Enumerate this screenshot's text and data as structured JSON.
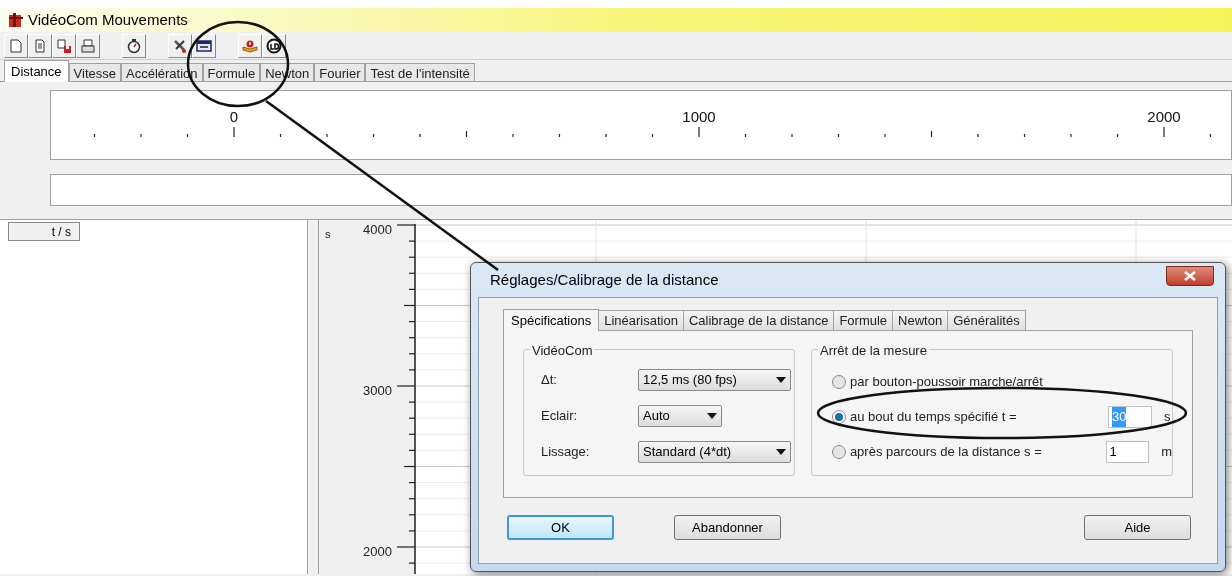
{
  "window": {
    "title": "VidéoCom Mouvements"
  },
  "tabs": [
    {
      "label": "Distance",
      "selected": true
    },
    {
      "label": "Vitesse",
      "selected": false
    },
    {
      "label": "Accélération",
      "selected": false
    },
    {
      "label": "Formule",
      "selected": false
    },
    {
      "label": "Newton",
      "selected": false
    },
    {
      "label": "Fourier",
      "selected": false
    },
    {
      "label": "Test de l'intensité",
      "selected": false
    }
  ],
  "ruler": {
    "labels": [
      "0",
      "1000",
      "2000"
    ]
  },
  "table": {
    "columns": [
      "t / s"
    ]
  },
  "y_axis": {
    "unit": "s",
    "labels": [
      "4000",
      "3000",
      "2000"
    ]
  },
  "dialog": {
    "title": "Réglages/Calibrage de la distance",
    "tabs": [
      {
        "label": "Spécifications",
        "selected": true
      },
      {
        "label": "Linéarisation",
        "selected": false
      },
      {
        "label": "Calibrage de la distance",
        "selected": false
      },
      {
        "label": "Formule",
        "selected": false
      },
      {
        "label": "Newton",
        "selected": false
      },
      {
        "label": "Généralités",
        "selected": false
      }
    ],
    "settings": {
      "title": "VidéoCom",
      "fields": [
        {
          "label": "Δt:",
          "value": "12,5 ms (80 fps)"
        },
        {
          "label": "Eclair:",
          "value": "Auto"
        },
        {
          "label": "Lissage:",
          "value": "Standard (4*dt)"
        }
      ]
    },
    "stop": {
      "title": "Arrêt de la mesure",
      "options": [
        {
          "label": "par bouton-poussoir marche/arrêt",
          "selected": false
        },
        {
          "label": "au bout du temps spécifié t =",
          "selected": true,
          "value": "30",
          "unit": "s",
          "highlighted": true
        },
        {
          "label": "après parcours de la distance s =",
          "selected": false,
          "value": "1",
          "unit": "m",
          "highlighted": false
        }
      ]
    },
    "buttons": [
      {
        "label": "OK",
        "default": true
      },
      {
        "label": "Abandonner",
        "default": false
      },
      {
        "label": "Aide",
        "default": false
      }
    ]
  }
}
